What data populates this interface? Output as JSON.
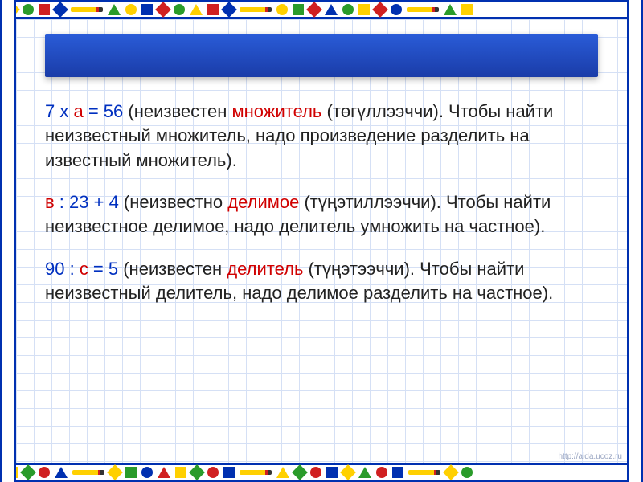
{
  "paragraphs": [
    {
      "eq_pre": "7 х ",
      "eq_var": "а",
      "eq_post": " = 56 ",
      "term_pre": "(неизвестен ",
      "term": "множитель",
      "term_post": " (төгүллээччи). ",
      "body": "Чтобы найти неизвестный множитель, надо произведение разделить на известный множитель)."
    },
    {
      "eq_pre": "",
      "eq_var": "в",
      "eq_post": " : 23 + 4 ",
      "term_pre": "(неизвестно ",
      "term": "делимое",
      "term_post": " (түңэтиллээччи). ",
      "body": "Чтобы найти неизвестное делимое, надо делитель умножить на частное)."
    },
    {
      "eq_pre": "90 : ",
      "eq_var": "с",
      "eq_post": " = 5 ",
      "term_pre": "(неизвестен ",
      "term": "делитель",
      "term_post": " (түңэтээччи). ",
      "body": "Чтобы найти неизвестный делитель, надо делимое разделить на частное)."
    }
  ],
  "footer": "http://aida.ucoz.ru"
}
